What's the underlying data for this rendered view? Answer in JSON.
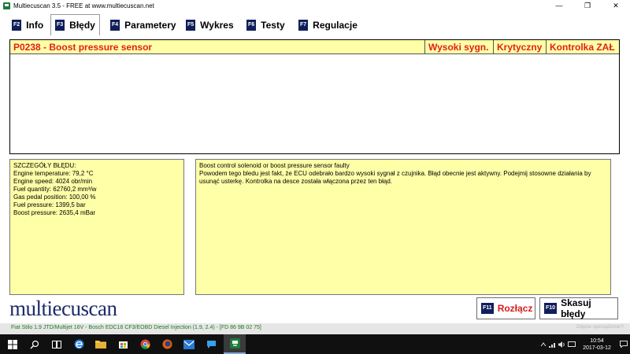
{
  "window": {
    "title": "Multiecuscan 3.5 - FREE at www.multiecuscan.net",
    "minimize": "—",
    "maximize": "❐",
    "close": "✕"
  },
  "tabs": [
    {
      "key": "F2",
      "label": "Info",
      "active": false
    },
    {
      "key": "F3",
      "label": "Błędy",
      "active": true
    },
    {
      "key": "F4",
      "label": "Parametery",
      "active": false
    },
    {
      "key": "F5",
      "label": "Wykres",
      "active": false
    },
    {
      "key": "F6",
      "label": "Testy",
      "active": false
    },
    {
      "key": "F7",
      "label": "Regulacje",
      "active": false
    }
  ],
  "fault_table": {
    "code": "P0238 - Boost pressure sensor",
    "col_high": "Wysoki sygn.",
    "col_critical": "Krytyczny",
    "col_lamp": "Kontrolka ZAŁ"
  },
  "details": {
    "heading": "SZCZEGÓŁY BŁĘDU:",
    "lines": [
      "Engine temperature: 79,2 °C",
      "Engine speed: 4024 obr/min",
      "Fuel quantity: 62760,2 mm³/w",
      "Gas pedal position: 100,00 %",
      "Fuel pressure: 1399,5 bar",
      "Boost pressure: 2635,4 mBar"
    ]
  },
  "description": {
    "line1": "Boost control solenoid or boost pressure sensor faulty",
    "line2": "Powodem tego bledu jest fakt, że ECU odebrało bardzo wysoki sygnał z czujnika. Błąd obecnie jest aktywny. Podejmij stosowne działania by usunąć usterkę. Kontrolka na desce została włączona przez ten błąd."
  },
  "logo": "multiecuscan",
  "buttons": {
    "disconnect": {
      "key": "F11",
      "label": "Rozłącz"
    },
    "clear": {
      "key": "F10",
      "label": "Skasuj błędy"
    }
  },
  "status": {
    "vehicle": "Fiat Stilo 1.9 JTD/Multijet 16V - Bosch EDC16 CF3/EOBD Diesel Injection (1.9, 2.4) - [FD 86 9B 02 75]",
    "right": "Zdjęcie sporządzone!?"
  },
  "taskbar": {
    "time": "10:54",
    "date": "2017-03-12"
  },
  "colors": {
    "accent_red": "#e0201a",
    "panel_yellow": "#ffffa8",
    "fkey_navy": "#0f1f5a",
    "logo_navy": "#1d2a6b",
    "status_green": "#1f7a1f"
  }
}
